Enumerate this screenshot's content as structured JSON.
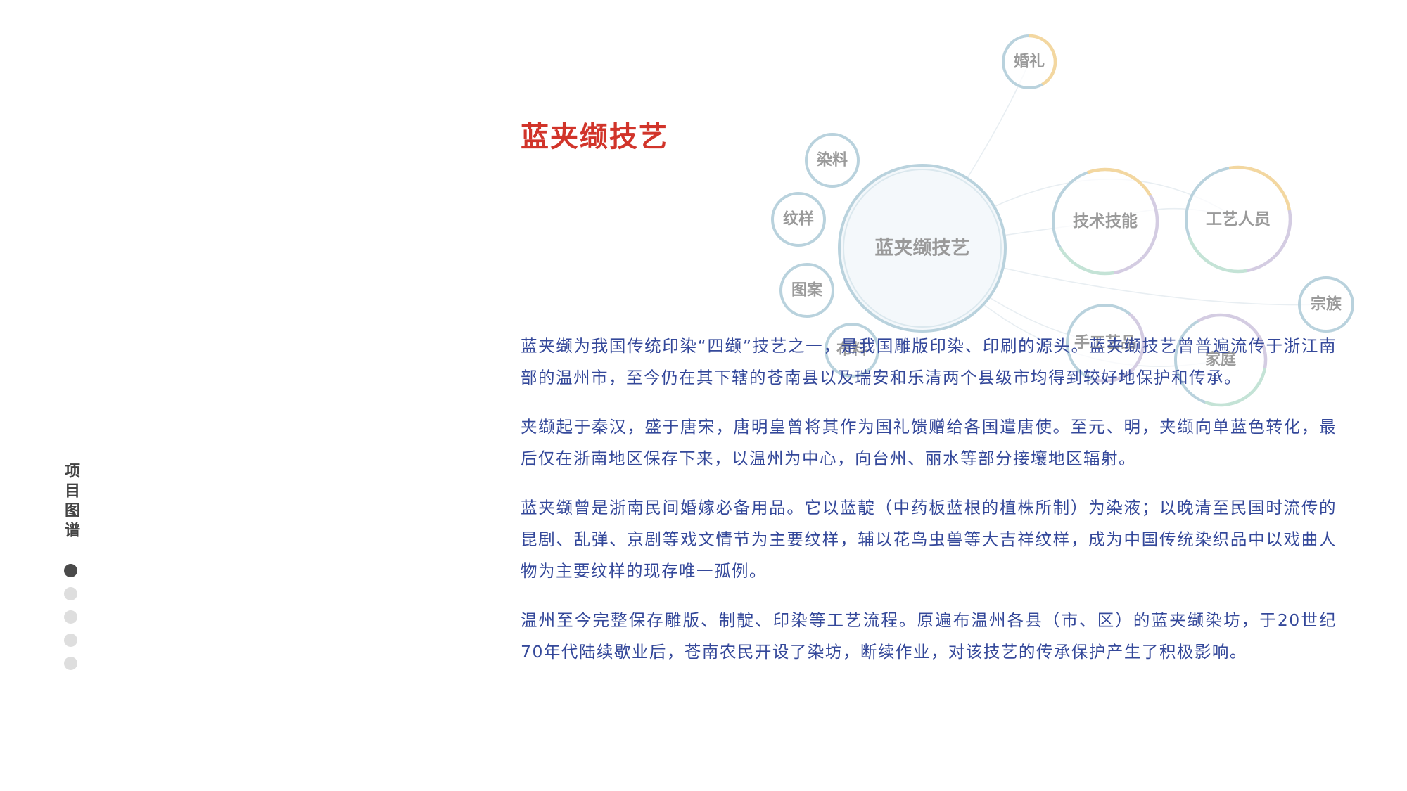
{
  "title": "蓝夹缬技艺",
  "sidebar": {
    "title": "项目图谱",
    "dots": [
      {
        "active": true
      },
      {
        "active": false
      },
      {
        "active": false
      },
      {
        "active": false
      },
      {
        "active": false
      }
    ]
  },
  "diagram": {
    "center": "蓝夹缬技艺",
    "nodes": {
      "hunli": "婚礼",
      "ranliao": "染料",
      "wenyang": "纹样",
      "tuan": "图案",
      "buliao": "布料",
      "jishu": "技术技能",
      "gongyi_renyuan": "工艺人员",
      "zongzu": "宗族",
      "shougong": "手工艺品",
      "jiating": "家庭"
    },
    "colors": {
      "ring": "#b9d2dd",
      "accent_yellow": "#f3d7a0",
      "accent_purple": "#d4cce2",
      "accent_green": "#c4e3d6",
      "center_fill": "#f4f8fb",
      "link": "#e8eef2"
    }
  },
  "paragraphs": [
    "蓝夹缬为我国传统印染“四缬”技艺之一，是我国雕版印染、印刷的源头。蓝夹缬技艺曾普遍流传于浙江南部的温州市，至今仍在其下辖的苍南县以及瑞安和乐清两个县级市均得到较好地保护和传承。",
    "夹缬起于秦汉，盛于唐宋，唐明皇曾将其作为国礼馈赠给各国遣唐使。至元、明，夹缬向单蓝色转化，最后仅在浙南地区保存下来，以温州为中心，向台州、丽水等部分接壤地区辐射。",
    "蓝夹缬曾是浙南民间婚嫁必备用品。它以蓝靛（中药板蓝根的植株所制）为染液；以晚清至民国时流传的昆剧、乱弹、京剧等戏文情节为主要纹样，辅以花鸟虫兽等大吉祥纹样，成为中国传统染织品中以戏曲人物为主要纹样的现存唯一孤例。",
    "温州至今完整保存雕版、制靛、印染等工艺流程。原遍布温州各县（市、区）的蓝夹缬染坊，于20世纪70年代陆续歇业后，苍南农民开设了染坊，断续作业，对该技艺的传承保护产生了积极影响。"
  ]
}
